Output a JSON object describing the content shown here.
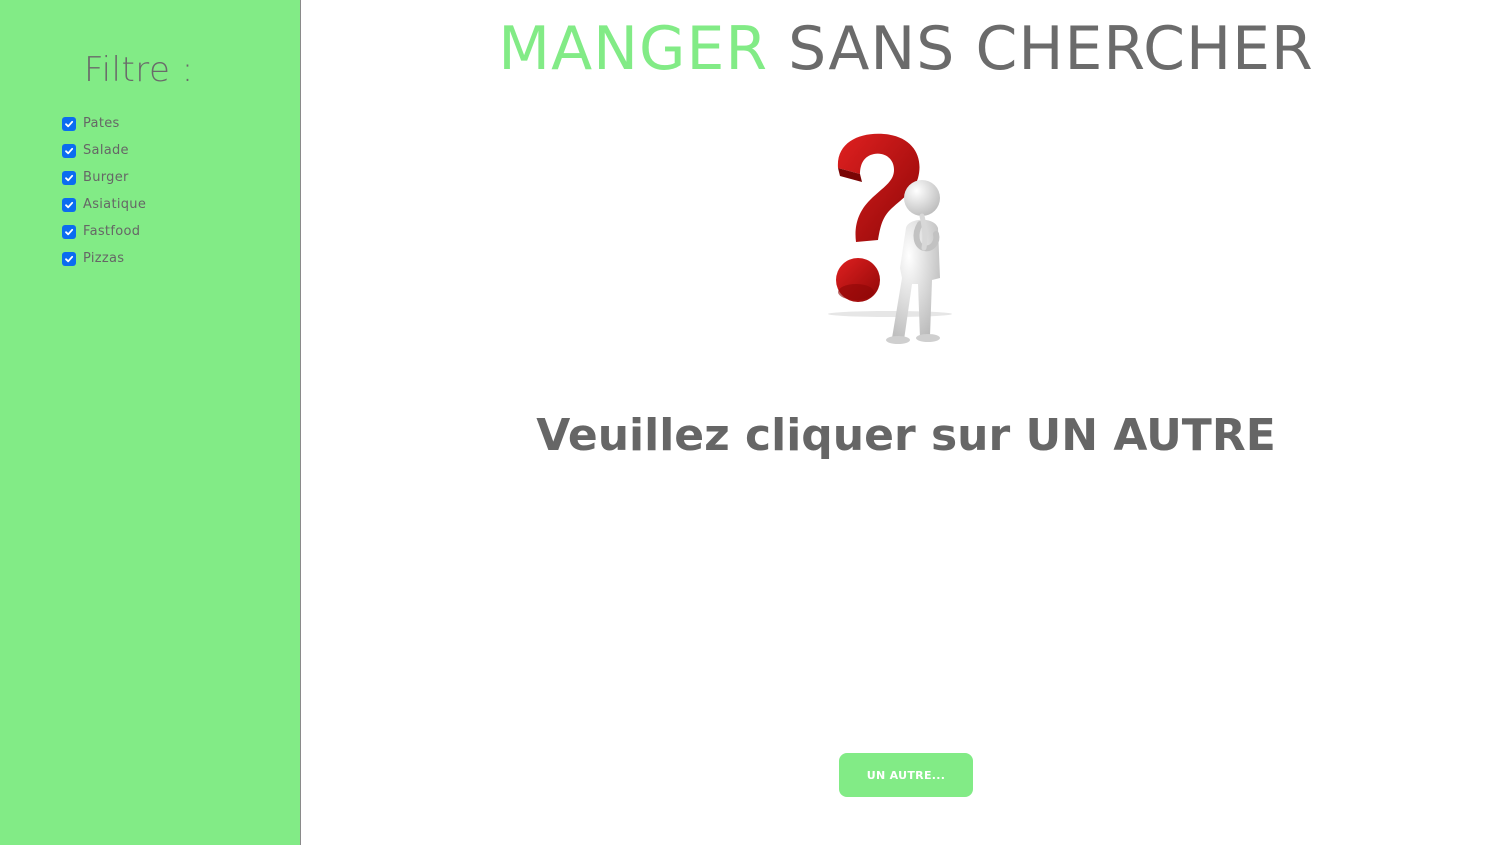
{
  "sidebar": {
    "title": "Filtre :",
    "filters": [
      {
        "label": "Pates",
        "checked": true
      },
      {
        "label": "Salade",
        "checked": true
      },
      {
        "label": "Burger",
        "checked": true
      },
      {
        "label": "Asiatique",
        "checked": true
      },
      {
        "label": "Fastfood",
        "checked": true
      },
      {
        "label": "Pizzas",
        "checked": true
      }
    ]
  },
  "header": {
    "title_accent": "MANGER",
    "title_rest": " SANS CHERCHER"
  },
  "main": {
    "illustration_icon": "thinking-figure-question-mark-icon",
    "message": "Veuillez cliquer sur UN AUTRE",
    "button_label": "UN AUTRE..."
  },
  "colors": {
    "accent": "#82eb86",
    "text": "#6b6b6b",
    "checkbox": "#0b6cf0",
    "question_mark": "#c40d0d"
  }
}
